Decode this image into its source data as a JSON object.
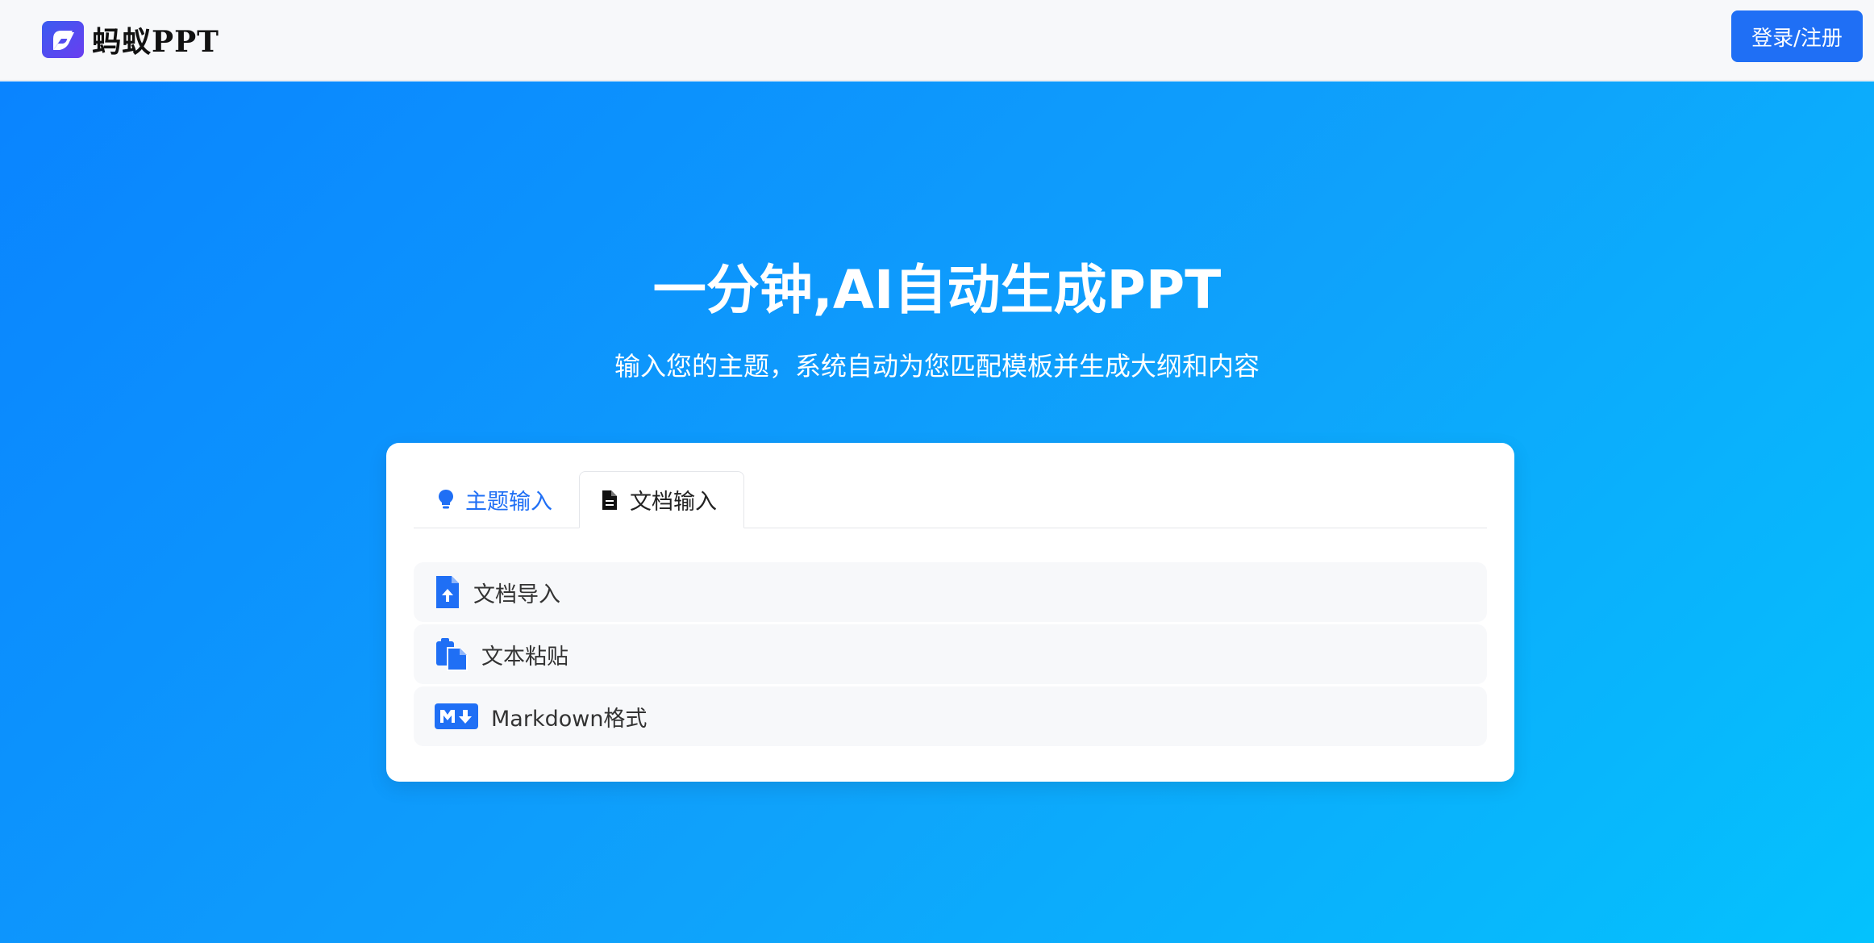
{
  "header": {
    "logo_text": "蚂蚁PPT",
    "logo_icon": "ant-ppt-logo-icon",
    "login_label": "登录/注册"
  },
  "hero": {
    "title": "一分钟,AI自动生成PPT",
    "subtitle": "输入您的主题，系统自动为您匹配模板并生成大纲和内容"
  },
  "tabs": [
    {
      "label": "主题输入",
      "icon": "lightbulb-icon",
      "active": false
    },
    {
      "label": "文档输入",
      "icon": "document-icon",
      "active": true
    }
  ],
  "options": [
    {
      "label": "文档导入",
      "icon": "file-upload-icon"
    },
    {
      "label": "文本粘贴",
      "icon": "paste-icon"
    },
    {
      "label": "Markdown格式",
      "icon": "markdown-icon"
    }
  ],
  "colors": {
    "brand": "#1f6ff5",
    "gradient_start": "#0a84ff",
    "gradient_end": "#04c2fd"
  }
}
